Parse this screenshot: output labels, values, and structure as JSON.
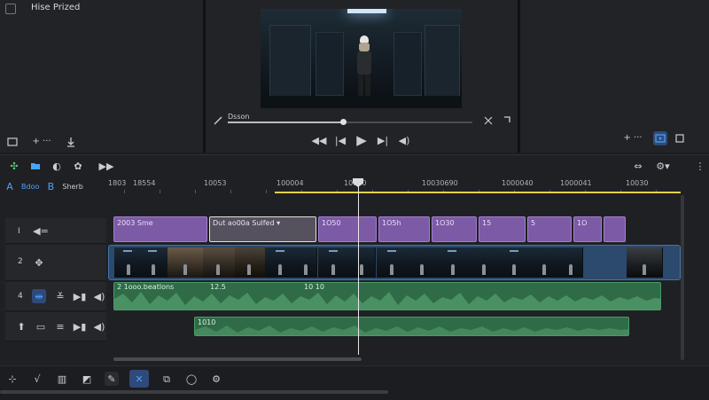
{
  "app": {
    "title": "Hise Prized"
  },
  "viewer": {
    "clip_label": "Dsson"
  },
  "toolbar": {
    "zoom_label": "+ ···"
  },
  "timeline": {
    "tabs": [
      {
        "label": "Bdoo"
      },
      {
        "label": "Sherb"
      }
    ],
    "ruler": [
      "1803",
      "18554",
      "10053",
      "100004",
      "10010",
      "10030690",
      "1000040",
      "1000041",
      "10030"
    ],
    "tracks": [
      {
        "number": "I"
      },
      {
        "number": "2"
      },
      {
        "number": "4"
      },
      {
        "number": ""
      }
    ],
    "title_clips": [
      {
        "label": "2003 Sme"
      },
      {
        "label": "Dut ao00a Sulfed ▾"
      },
      {
        "label": "1O50"
      },
      {
        "label": "1O5h"
      },
      {
        "label": "1O30"
      },
      {
        "label": "15"
      },
      {
        "label": "5"
      },
      {
        "label": "1O"
      }
    ],
    "audio_clips": [
      {
        "label": "2 1ooo.beatlons"
      },
      {
        "label": "12.5"
      },
      {
        "label": "10 10"
      },
      {
        "label": "1010"
      }
    ]
  },
  "colors": {
    "accent": "#4aa3ff",
    "title_clip": "#7c5aa6",
    "audio_clip": "#2f6b47",
    "video_clip": "#2b4a6e",
    "playhead": "#e8e8e8",
    "ruler_range": "#e3d24a"
  }
}
